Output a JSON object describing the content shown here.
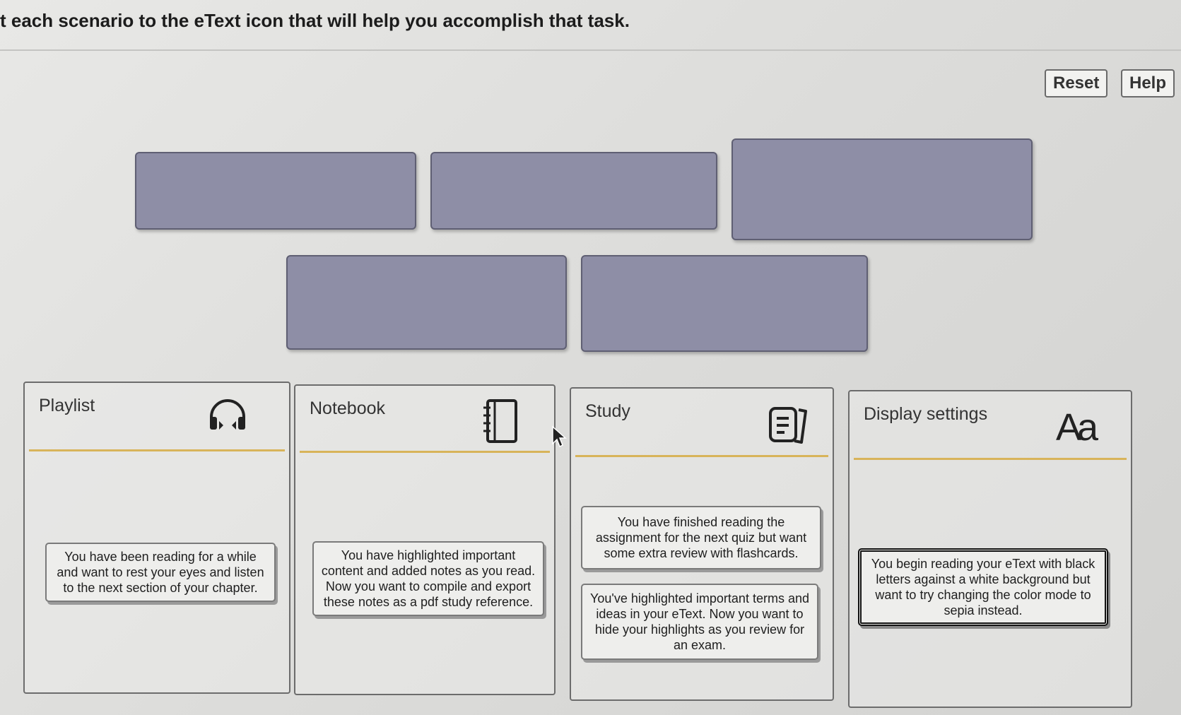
{
  "instruction": "t each scenario to the eText icon that will help you accomplish that task.",
  "buttons": {
    "reset": "Reset",
    "help": "Help"
  },
  "categories": [
    {
      "title": "Playlist",
      "icon": "headphones-icon"
    },
    {
      "title": "Notebook",
      "icon": "notebook-icon"
    },
    {
      "title": "Study",
      "icon": "flashcards-icon"
    },
    {
      "title": "Display settings",
      "icon": "font-size-icon",
      "icon_text": "Aa"
    }
  ],
  "cards": {
    "playlist_card": "You have been reading for a while and want to rest your eyes and listen to the next section of your chapter.",
    "notebook_card": "You have highlighted important content and added notes as you read. Now you want to compile and export these notes as a pdf study reference.",
    "study_card_1": "You have finished reading the assignment for the next quiz but want some extra review with flashcards.",
    "study_card_2": "You've highlighted important terms and ideas in your eText. Now you want to hide your highlights as you review for an exam.",
    "display_card": "You begin reading your eText with black letters against a white background but want to try changing the color mode to sepia instead."
  },
  "colors": {
    "dropzone": "#8e8ea6",
    "divider_accent": "#d8b45a"
  }
}
